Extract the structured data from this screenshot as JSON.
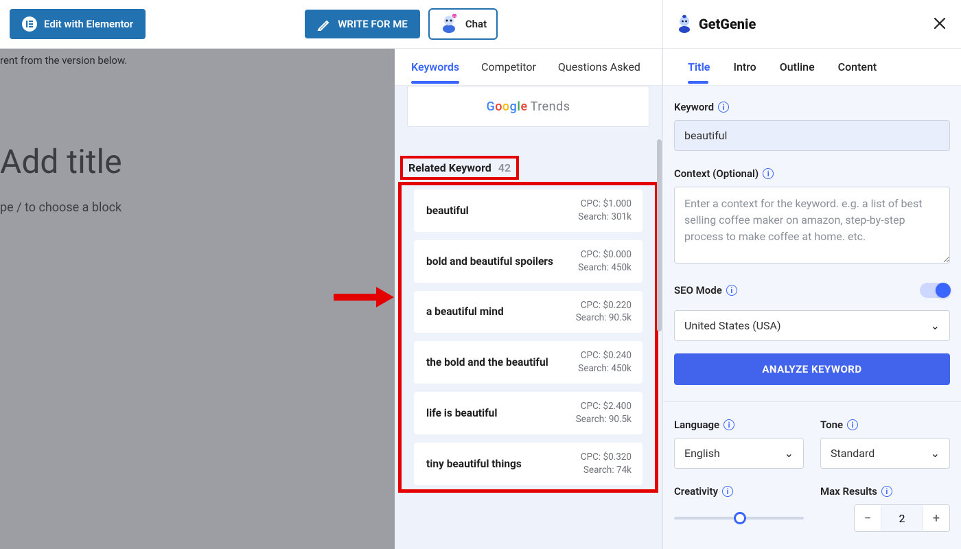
{
  "toolbar": {
    "elementor_label": "Edit with Elementor",
    "write_label": "WRITE FOR ME",
    "chat_label": "Chat"
  },
  "editor": {
    "revision_note": "rent from the version below.",
    "title_placeholder": "Add title",
    "type_hint": "pe / to choose a block"
  },
  "mid": {
    "tabs": [
      "Keywords",
      "Competitor",
      "Questions Asked"
    ],
    "active_tab": 0,
    "trends_label": "Trends",
    "related_header": "Related Keyword",
    "related_count": "42",
    "keywords": [
      {
        "name": "beautiful",
        "cpc": "CPC: $1.000",
        "search": "Search: 301k"
      },
      {
        "name": "bold and beautiful spoilers",
        "cpc": "CPC: $0.000",
        "search": "Search: 450k"
      },
      {
        "name": "a beautiful mind",
        "cpc": "CPC: $0.220",
        "search": "Search: 90.5k"
      },
      {
        "name": "the bold and the beautiful",
        "cpc": "CPC: $0.240",
        "search": "Search: 450k"
      },
      {
        "name": "life is beautiful",
        "cpc": "CPC: $2.400",
        "search": "Search: 90.5k"
      },
      {
        "name": "tiny beautiful things",
        "cpc": "CPC: $0.320",
        "search": "Search: 74k"
      }
    ]
  },
  "right": {
    "brand": "GetGenie",
    "tabs": [
      "Title",
      "Intro",
      "Outline",
      "Content"
    ],
    "active_tab": 0,
    "keyword_label": "Keyword",
    "keyword_value": "beautiful",
    "context_label": "Context (Optional)",
    "context_placeholder": "Enter a context for the keyword. e.g. a list of best selling coffee maker on amazon, step-by-step process to make coffee at home. etc.",
    "seo_label": "SEO Mode",
    "country_value": "United States (USA)",
    "analyze_label": "ANALYZE KEYWORD",
    "language_label": "Language",
    "language_value": "English",
    "tone_label": "Tone",
    "tone_value": "Standard",
    "creativity_label": "Creativity",
    "max_results_label": "Max Results",
    "max_results_value": "2"
  }
}
